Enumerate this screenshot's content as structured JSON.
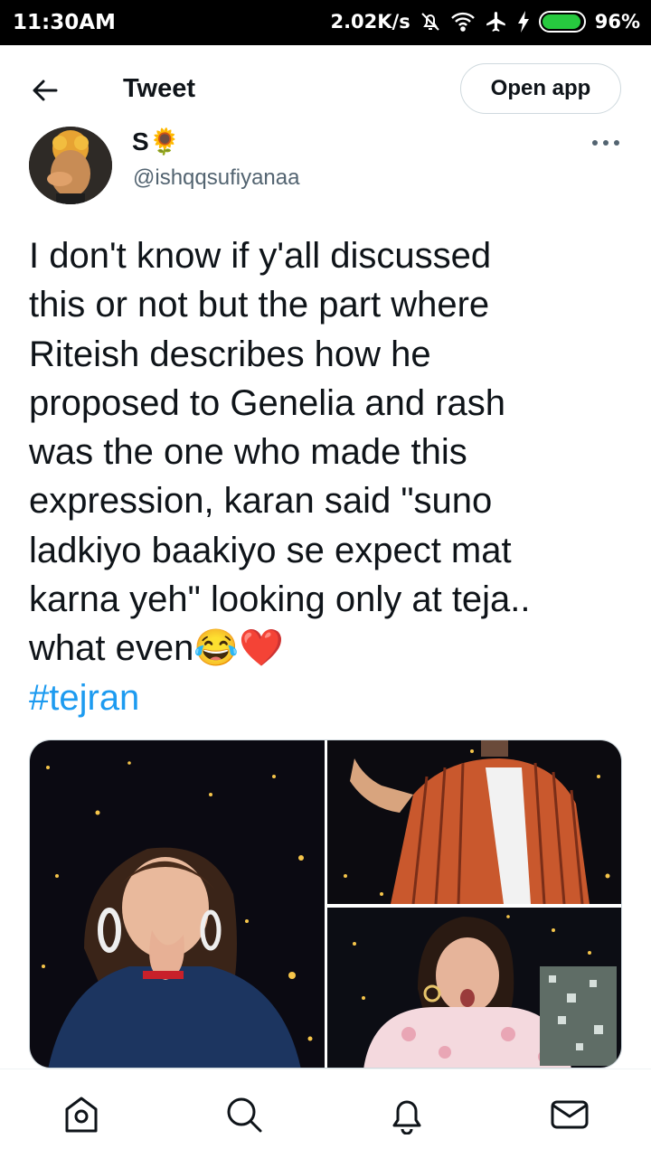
{
  "status_bar": {
    "time": "11:30AM",
    "network_speed": "2.02K/s",
    "battery_percent": "96%",
    "battery_level": 0.96,
    "icons": [
      "mute-icon",
      "wifi-icon",
      "airplane-icon",
      "charging-icon",
      "battery-icon"
    ]
  },
  "header": {
    "title": "Tweet",
    "open_app_label": "Open app",
    "back_icon": "arrow-left-icon"
  },
  "tweet": {
    "author_name": "S🌻",
    "author_handle": "@ishqqsufiyanaa",
    "text_lines": [
      "I don't know if y'all discussed",
      "this or not but the part where",
      "Riteish describes how he",
      "proposed to Genelia and rash",
      "was the one who made this",
      "expression, karan said \"suno",
      "ladkiyo baakiyo se expect mat",
      "karna yeh\" looking only at teja..",
      "what even😂❤️"
    ],
    "hashtag": "#tejran",
    "more_icon": "more-horizontal-icon"
  },
  "bottom_nav": {
    "items": [
      "home-icon",
      "search-icon",
      "notifications-icon",
      "messages-icon"
    ]
  },
  "colors": {
    "accent": "#1d9bf0",
    "text": "#0f1419",
    "muted": "#536471",
    "border": "#cfd9de"
  }
}
